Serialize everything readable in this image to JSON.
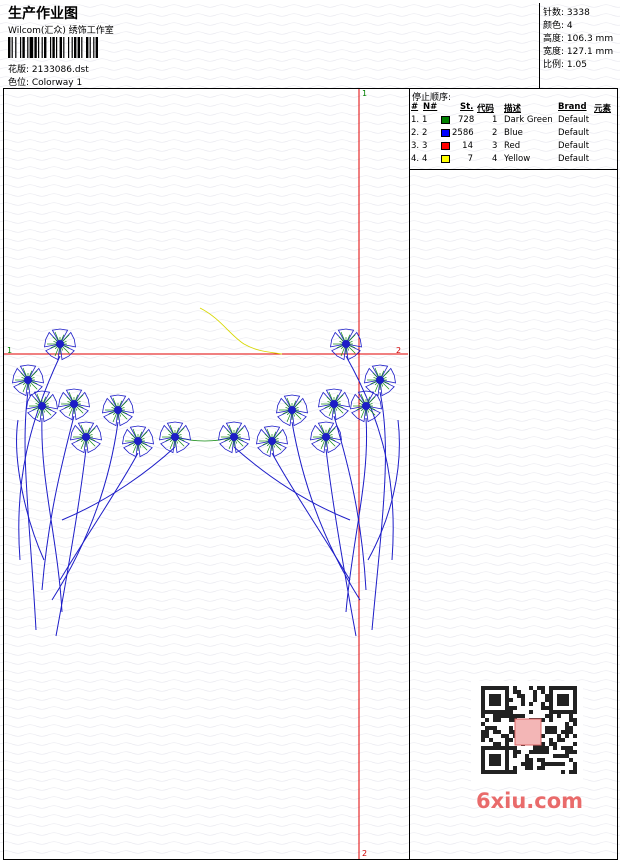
{
  "header": {
    "title": "生产作业图",
    "company": "Wilcom(汇众) 绣饰工作室",
    "design_label": "花版: 2133086.dst",
    "colorway_label": "色位:  Colorway 1"
  },
  "stats": [
    {
      "label": "针数:",
      "value": "3338"
    },
    {
      "label": "颜色:",
      "value": "4"
    },
    {
      "label": "高度:",
      "value": "106.3 mm"
    },
    {
      "label": "宽度:",
      "value": "127.1 mm"
    },
    {
      "label": "比例:",
      "value": "1.05"
    }
  ],
  "stop_sequence": {
    "title": "停止顺序:",
    "headers": [
      "#",
      "N#",
      "St.",
      "代码",
      "描述",
      "Brand",
      "元素"
    ],
    "rows": [
      {
        "idx": "1.",
        "n": "1",
        "color": "#008000",
        "stitches": "728",
        "code": "1",
        "desc": "Dark Green",
        "brand": "Default"
      },
      {
        "idx": "2.",
        "n": "2",
        "color": "#0000ff",
        "stitches": "2586",
        "code": "2",
        "desc": "Blue",
        "brand": "Default"
      },
      {
        "idx": "3.",
        "n": "3",
        "color": "#ff0000",
        "stitches": "14",
        "code": "3",
        "desc": "Red",
        "brand": "Default"
      },
      {
        "idx": "4.",
        "n": "4",
        "color": "#ffff00",
        "stitches": "7",
        "code": "4",
        "desc": "Yellow",
        "brand": "Default"
      }
    ]
  },
  "markers": {
    "v_top": "1",
    "v_bottom": "2",
    "h_left": "1",
    "h_right": "2"
  },
  "watermark": "6xiu.com"
}
